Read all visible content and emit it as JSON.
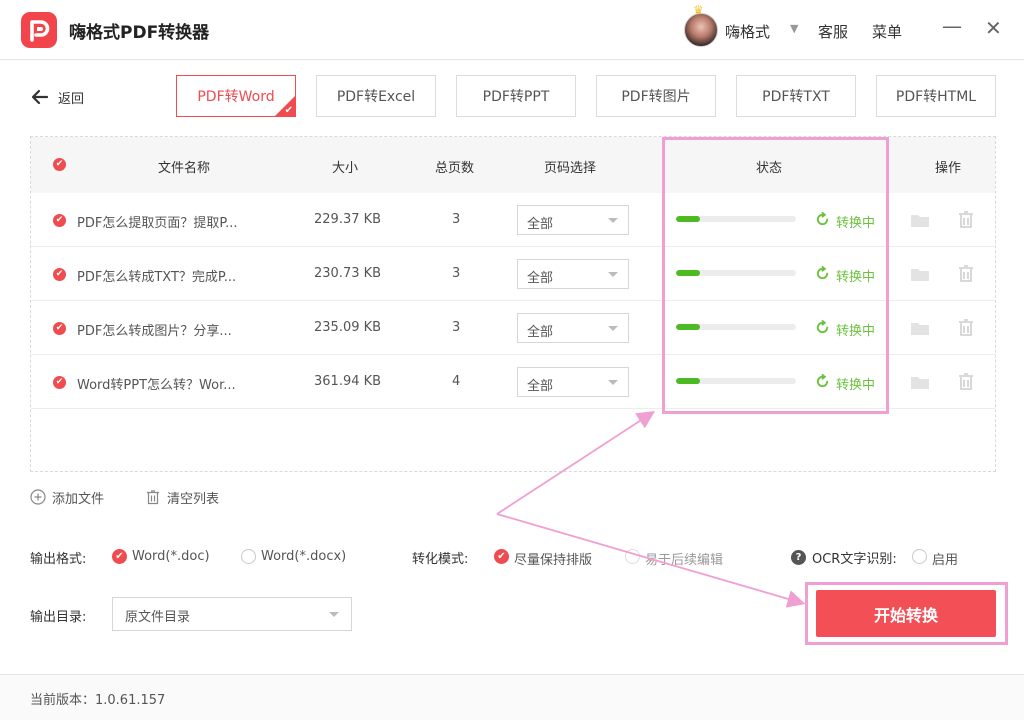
{
  "app": {
    "title": "嗨格式PDF转换器",
    "user_name": "嗨格式",
    "service_label": "客服",
    "menu_label": "菜单",
    "min_glyph": "—",
    "close_glyph": "✕"
  },
  "nav": {
    "back_label": "返回",
    "tabs": [
      {
        "label": "PDF转Word",
        "active": true
      },
      {
        "label": "PDF转Excel",
        "active": false
      },
      {
        "label": "PDF转PPT",
        "active": false
      },
      {
        "label": "PDF转图片",
        "active": false
      },
      {
        "label": "PDF转TXT",
        "active": false
      },
      {
        "label": "PDF转HTML",
        "active": false
      }
    ]
  },
  "table": {
    "headers": {
      "name": "文件名称",
      "size": "大小",
      "pages": "总页数",
      "range": "页码选择",
      "status": "状态",
      "actions": "操作"
    },
    "rows": [
      {
        "name": "PDF怎么提取页面？提取P...",
        "size": "229.37 KB",
        "pages": "3",
        "range": "全部",
        "progress": 0.2,
        "status": "转换中"
      },
      {
        "name": "PDF怎么转成TXT？完成P...",
        "size": "230.73 KB",
        "pages": "3",
        "range": "全部",
        "progress": 0.2,
        "status": "转换中"
      },
      {
        "name": "PDF怎么转成图片？分享...",
        "size": "235.09 KB",
        "pages": "3",
        "range": "全部",
        "progress": 0.2,
        "status": "转换中"
      },
      {
        "name": "Word转PPT怎么转？Wor...",
        "size": "361.94 KB",
        "pages": "4",
        "range": "全部",
        "progress": 0.2,
        "status": "转换中"
      }
    ]
  },
  "list_actions": {
    "add_file": "添加文件",
    "clear_list": "清空列表"
  },
  "options": {
    "format_label": "输出格式:",
    "format_doc": "Word(*.doc)",
    "format_docx": "Word(*.docx)",
    "mode_label": "转化模式:",
    "mode_keep_layout": "尽量保持排版",
    "mode_editable": "易于后续编辑",
    "ocr_label": "OCR文字识别:",
    "ocr_enable": "启用",
    "dir_label": "输出目录:",
    "dir_value": "原文件目录",
    "start_button": "开始转换"
  },
  "footer": {
    "version": "当前版本：1.0.61.157"
  },
  "colors": {
    "accent": "#f04b4f",
    "progress": "#4cba22",
    "status_text": "#6cc23e",
    "highlight": "#f09fd2"
  }
}
